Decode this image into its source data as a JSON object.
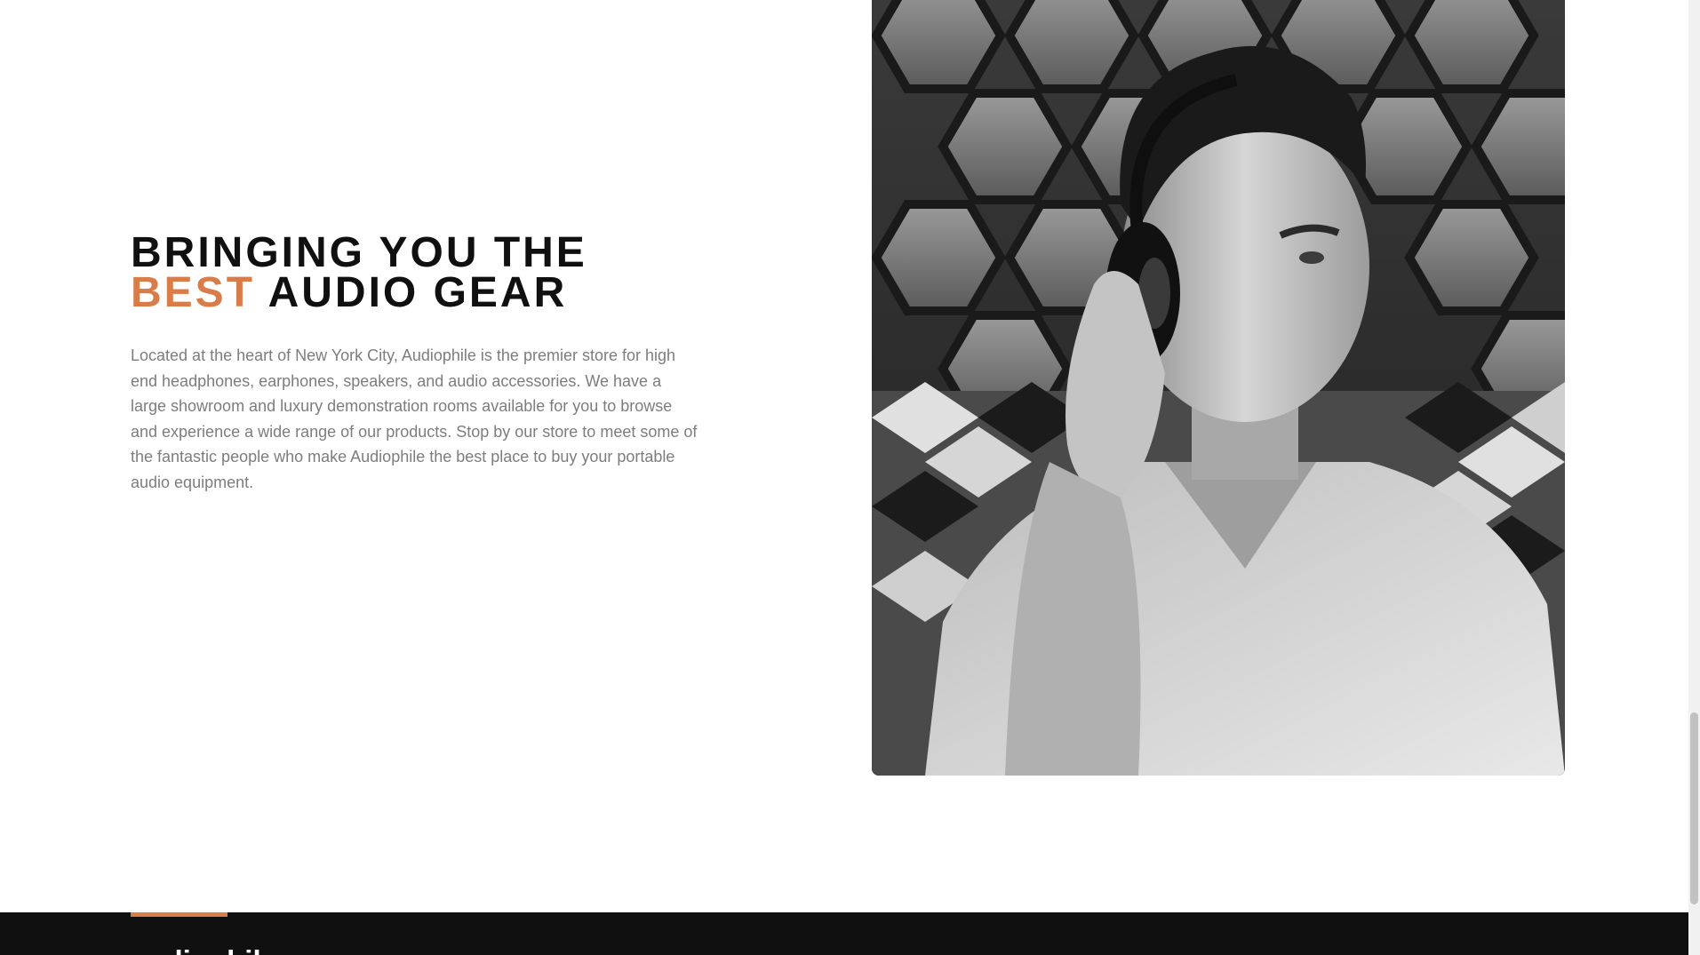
{
  "about": {
    "headline_line1": "Bringing you the",
    "headline_accent": "best",
    "headline_rest": "audio gear",
    "body": "Located at the heart of New York City, Audiophile is the premier store for high end headphones, earphones, speakers, and audio accessories. We have a large showroom and luxury demonstration rooms available for you to browse and experience a wide range of our products. Stop by our store to meet some of the fantastic people who make Audiophile the best place to buy your portable audio equipment."
  },
  "footer": {
    "logo": "audiophile"
  },
  "colors": {
    "accent": "#D87D4A",
    "heading": "#101010",
    "body_text": "#7d7d7d",
    "footer_bg": "#101010"
  }
}
